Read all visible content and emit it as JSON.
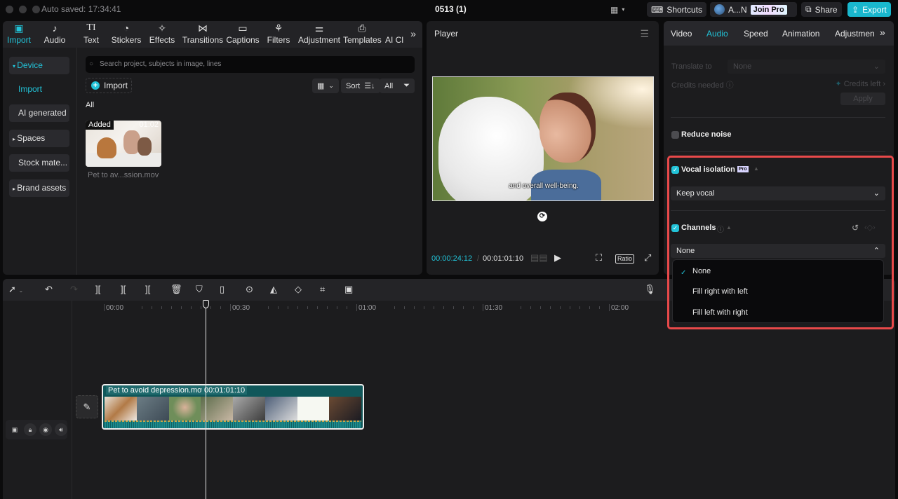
{
  "titlebar": {
    "autosave": "Auto saved: 17:34:41",
    "project_title": "0513 (1)",
    "layout_icon": "layout-icon",
    "shortcuts_label": "Shortcuts",
    "account_name": "A...N",
    "join_pro_label": "Join Pro",
    "share_label": "Share",
    "export_label": "Export"
  },
  "media_panel": {
    "tabs": [
      {
        "label": "Import",
        "icon": "import-icon",
        "active": true
      },
      {
        "label": "Audio",
        "icon": "audio-icon"
      },
      {
        "label": "Text",
        "icon": "text-icon"
      },
      {
        "label": "Stickers",
        "icon": "stickers-icon"
      },
      {
        "label": "Effects",
        "icon": "effects-icon"
      },
      {
        "label": "Transitions",
        "icon": "transitions-icon"
      },
      {
        "label": "Captions",
        "icon": "captions-icon"
      },
      {
        "label": "Filters",
        "icon": "filters-icon"
      },
      {
        "label": "Adjustment",
        "icon": "adjustment-icon"
      },
      {
        "label": "Templates",
        "icon": "templates-icon"
      },
      {
        "label": "AI Cl",
        "icon": ""
      }
    ],
    "sidebar": [
      {
        "label": "Device",
        "expanded": true,
        "active": true
      },
      {
        "label": "Import",
        "sub": true
      },
      {
        "label": "AI generated"
      },
      {
        "label": "Spaces"
      },
      {
        "label": "Stock mate..."
      },
      {
        "label": "Brand assets"
      }
    ],
    "search_placeholder": "Search project, subjects in image, lines",
    "import_label": "Import",
    "sort_label": "Sort",
    "filter_label": "All",
    "section_label": "All",
    "items": [
      {
        "badge": "Added",
        "duration": "01:02",
        "name": "Pet to av...ssion.mov"
      }
    ]
  },
  "player": {
    "title": "Player",
    "caption": "and overall well-being.",
    "current_time": "00:00:24:12",
    "total_time": "00:01:01:10",
    "ratio_label": "Ratio"
  },
  "inspector": {
    "tabs": [
      {
        "label": "Video"
      },
      {
        "label": "Audio",
        "active": true
      },
      {
        "label": "Speed"
      },
      {
        "label": "Animation"
      },
      {
        "label": "Adjustmen"
      }
    ],
    "translate_label": "Translate to",
    "translate_value": "None",
    "credits_needed_label": "Credits needed",
    "credits_left_label": "Credits left",
    "apply_label": "Apply",
    "reduce_noise": {
      "label": "Reduce noise",
      "checked": false
    },
    "vocal_isolation": {
      "label": "Vocal isolation",
      "badge": "Pro",
      "checked": true,
      "value": "Keep vocal"
    },
    "channels": {
      "label": "Channels",
      "checked": true,
      "value": "None",
      "options": [
        "None",
        "Fill right with left",
        "Fill left with right"
      ],
      "selected_index": 0
    }
  },
  "timeline": {
    "ruler_labels": [
      "00:00",
      "00:30",
      "01:00",
      "01:30",
      "02:00"
    ],
    "clip": {
      "name": "Pet to avoid depression.mov",
      "duration": "00:01:01:10"
    }
  },
  "colors": {
    "accent": "#22c3d8",
    "highlight": "#e8494a",
    "clip": "#10575a"
  }
}
